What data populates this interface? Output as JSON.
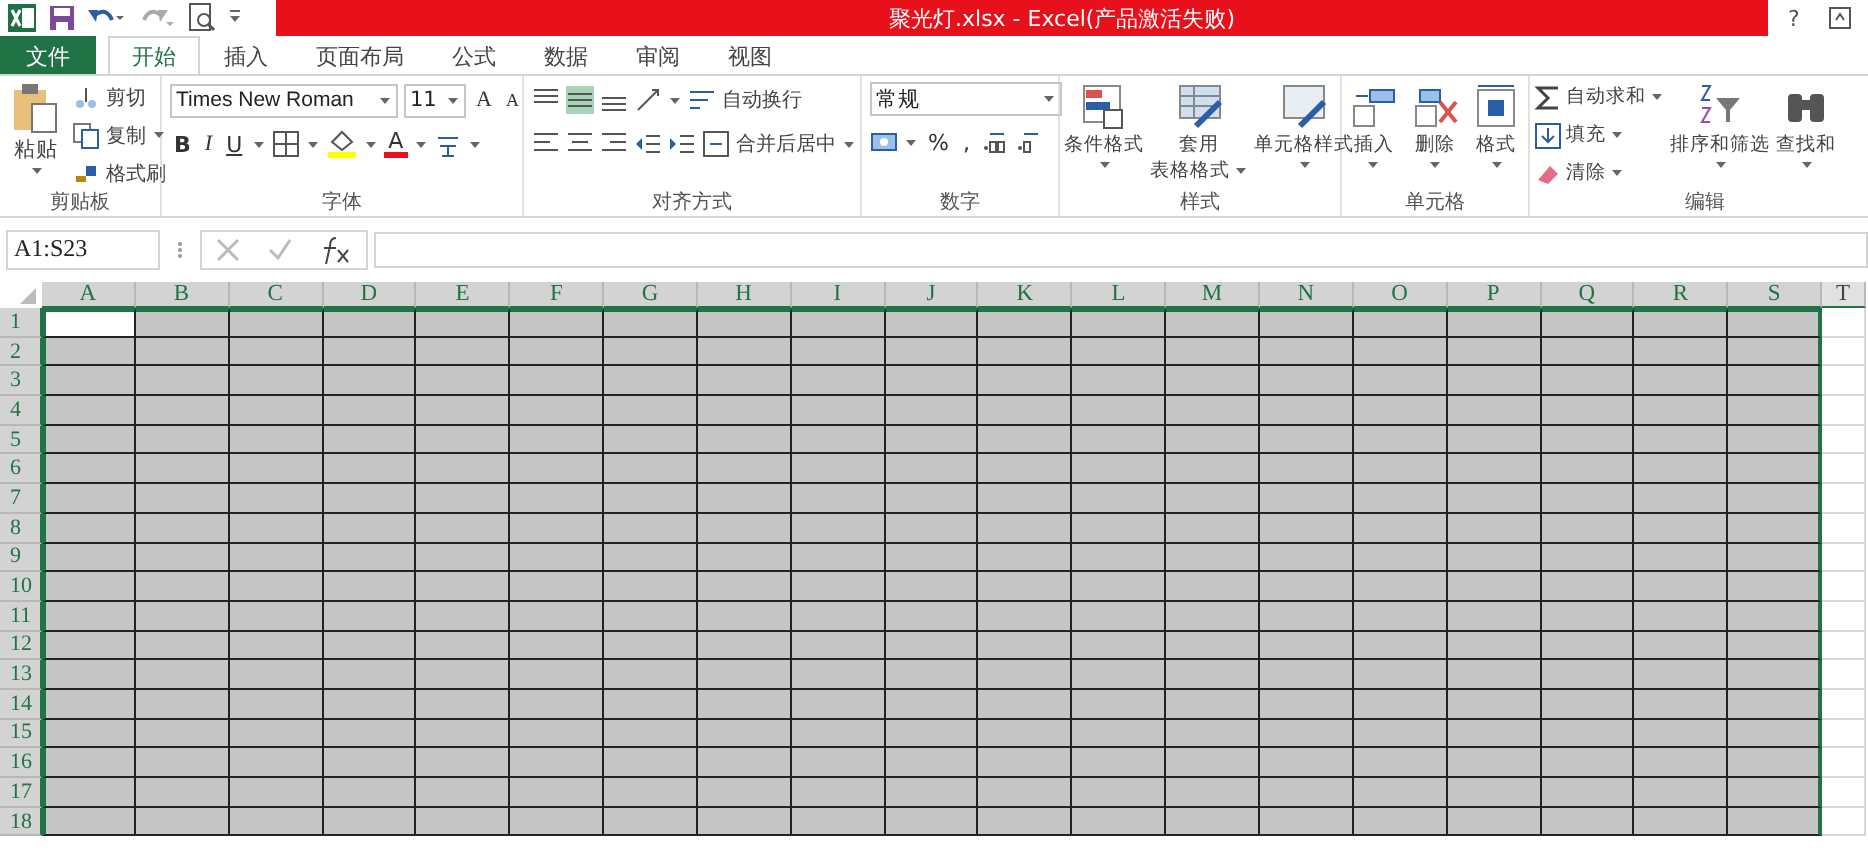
{
  "window": {
    "title": "聚光灯.xlsx -  Excel(产品激活失败)",
    "help": "?"
  },
  "tabs": [
    {
      "label": "文件",
      "kind": "file",
      "selected": false
    },
    {
      "label": "开始",
      "kind": "tab",
      "selected": true
    },
    {
      "label": "插入",
      "kind": "tab",
      "selected": false
    },
    {
      "label": "页面布局",
      "kind": "tab",
      "selected": false
    },
    {
      "label": "公式",
      "kind": "tab",
      "selected": false
    },
    {
      "label": "数据",
      "kind": "tab",
      "selected": false
    },
    {
      "label": "审阅",
      "kind": "tab",
      "selected": false
    },
    {
      "label": "视图",
      "kind": "tab",
      "selected": false
    }
  ],
  "ribbon": {
    "clipboard": {
      "name": "剪贴板",
      "paste": "粘贴",
      "items": [
        "剪切",
        "复制",
        "格式刷"
      ]
    },
    "font": {
      "name": "字体",
      "font_name": "Times New Roman",
      "font_size": "11",
      "grow": "A",
      "shrink": "A",
      "styles": [
        "B",
        "I",
        "U"
      ],
      "font_color": "A"
    },
    "alignment": {
      "name": "对齐方式",
      "wrap": "自动换行",
      "merge": "合并后居中"
    },
    "number": {
      "name": "数字",
      "format": "常规",
      "percent": "%",
      "comma": ","
    },
    "styles": {
      "name": "样式",
      "items": [
        [
          "条件格式"
        ],
        [
          "套用",
          "表格格式"
        ],
        [
          "单元格样式"
        ]
      ]
    },
    "cells": {
      "name": "单元格",
      "items": [
        "插入",
        "删除",
        "格式"
      ]
    },
    "editing": {
      "name": "编辑",
      "items": [
        "自动求和",
        "填充",
        "清除"
      ],
      "big": [
        "排序和筛选",
        "查找和"
      ]
    }
  },
  "formula_bar": {
    "name_box": "A1:S23"
  },
  "sheet": {
    "columns": [
      {
        "label": "A",
        "selected": true
      },
      {
        "label": "B",
        "selected": true
      },
      {
        "label": "C",
        "selected": true
      },
      {
        "label": "D",
        "selected": true
      },
      {
        "label": "E",
        "selected": true
      },
      {
        "label": "F",
        "selected": true
      },
      {
        "label": "G",
        "selected": true
      },
      {
        "label": "H",
        "selected": true
      },
      {
        "label": "I",
        "selected": true
      },
      {
        "label": "J",
        "selected": true
      },
      {
        "label": "K",
        "selected": true
      },
      {
        "label": "L",
        "selected": true
      },
      {
        "label": "M",
        "selected": true
      },
      {
        "label": "N",
        "selected": true
      },
      {
        "label": "O",
        "selected": true
      },
      {
        "label": "P",
        "selected": true
      },
      {
        "label": "Q",
        "selected": true
      },
      {
        "label": "R",
        "selected": true
      },
      {
        "label": "S",
        "selected": true
      },
      {
        "label": "T",
        "selected": false
      }
    ],
    "rows": [
      {
        "label": "1",
        "selected": true
      },
      {
        "label": "2",
        "selected": true
      },
      {
        "label": "3",
        "selected": true
      },
      {
        "label": "4",
        "selected": true
      },
      {
        "label": "5",
        "selected": true
      },
      {
        "label": "6",
        "selected": true
      },
      {
        "label": "7",
        "selected": true
      },
      {
        "label": "8",
        "selected": true
      },
      {
        "label": "9",
        "selected": true
      },
      {
        "label": "10",
        "selected": true
      },
      {
        "label": "11",
        "selected": true
      },
      {
        "label": "12",
        "selected": true
      },
      {
        "label": "13",
        "selected": true
      },
      {
        "label": "14",
        "selected": true
      },
      {
        "label": "15",
        "selected": true
      },
      {
        "label": "16",
        "selected": true
      },
      {
        "label": "17",
        "selected": true
      },
      {
        "label": "18",
        "selected": true
      }
    ]
  }
}
